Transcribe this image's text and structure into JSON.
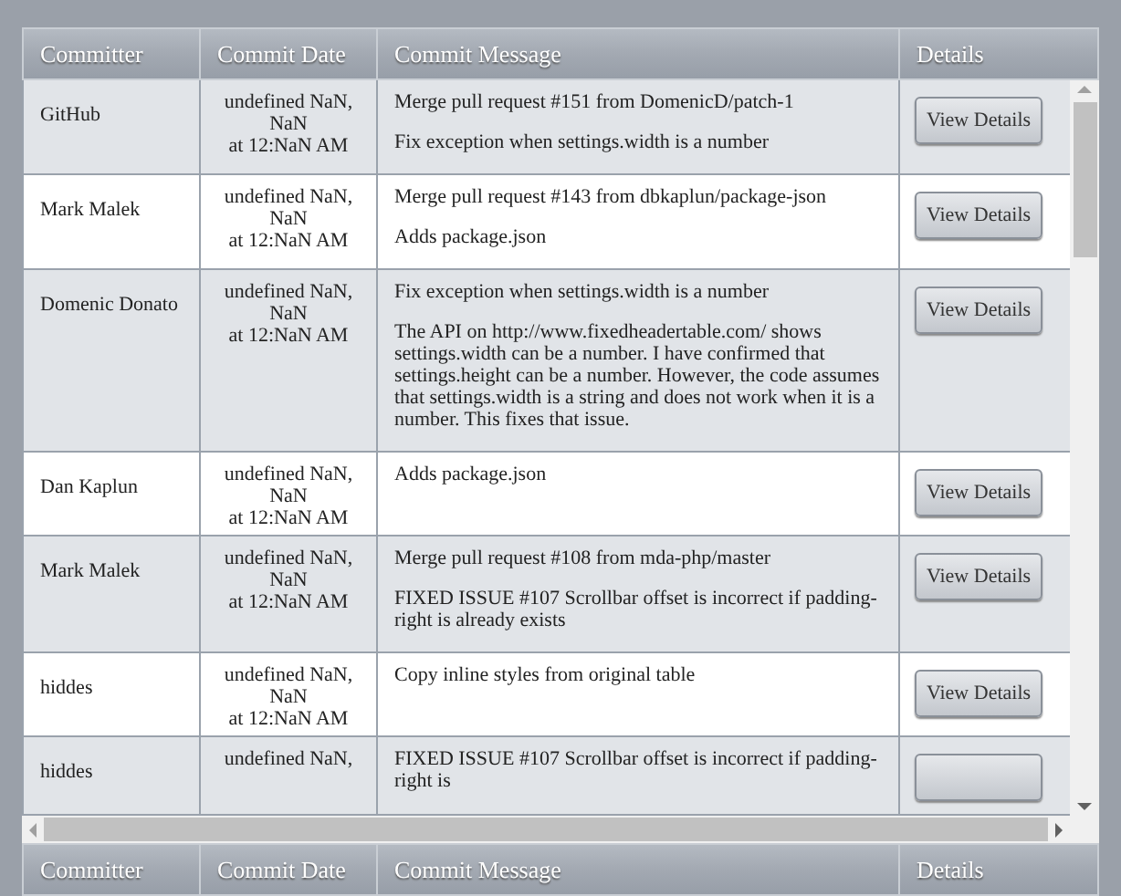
{
  "header": {
    "columns": [
      "Committer",
      "Commit Date",
      "Commit Message",
      "Details"
    ]
  },
  "rows": [
    {
      "committer": "GitHub",
      "date": [
        "undefined NaN,",
        "NaN",
        "at 12:NaN AM"
      ],
      "message": [
        "Merge pull request #151 from DomenicD/patch-1",
        "Fix exception when settings.width is a number"
      ],
      "details": "View Details"
    },
    {
      "committer": "Mark Malek",
      "date": [
        "undefined NaN,",
        "NaN",
        "at 12:NaN AM"
      ],
      "message": [
        "Merge pull request #143 from dbkaplun/package-json",
        "Adds package.json"
      ],
      "details": "View Details"
    },
    {
      "committer": "Domenic Donato",
      "date": [
        "undefined NaN,",
        "NaN",
        "at 12:NaN AM"
      ],
      "message": [
        "Fix exception when settings.width is a number",
        "The API on http://www.fixedheadertable.com/ shows settings.width can be a number. I have confirmed that settings.height can be a number. However, the code assumes that settings.width is a string and does not work when it is a number. This fixes that issue."
      ],
      "details": "View Details"
    },
    {
      "committer": "Dan Kaplun",
      "date": [
        "undefined NaN,",
        "NaN",
        "at 12:NaN AM"
      ],
      "message": [
        "Adds package.json"
      ],
      "details": "View Details"
    },
    {
      "committer": "Mark Malek",
      "date": [
        "undefined NaN,",
        "NaN",
        "at 12:NaN AM"
      ],
      "message": [
        "Merge pull request #108 from mda-php/master",
        "FIXED ISSUE #107 Scrollbar offset is incorrect if padding-right is already exists"
      ],
      "details": "View Details"
    },
    {
      "committer": "hiddes",
      "date": [
        "undefined NaN,",
        "NaN",
        "at 12:NaN AM"
      ],
      "message": [
        "Copy inline styles from original table"
      ],
      "details": "View Details"
    },
    {
      "committer": "hiddes",
      "date": [
        "undefined NaN,"
      ],
      "message": [
        "FIXED ISSUE #107 Scrollbar offset is incorrect if padding-right is"
      ]
    }
  ],
  "footer": {
    "columns": [
      "Committer",
      "Commit Date",
      "Commit Message",
      "Details"
    ]
  }
}
